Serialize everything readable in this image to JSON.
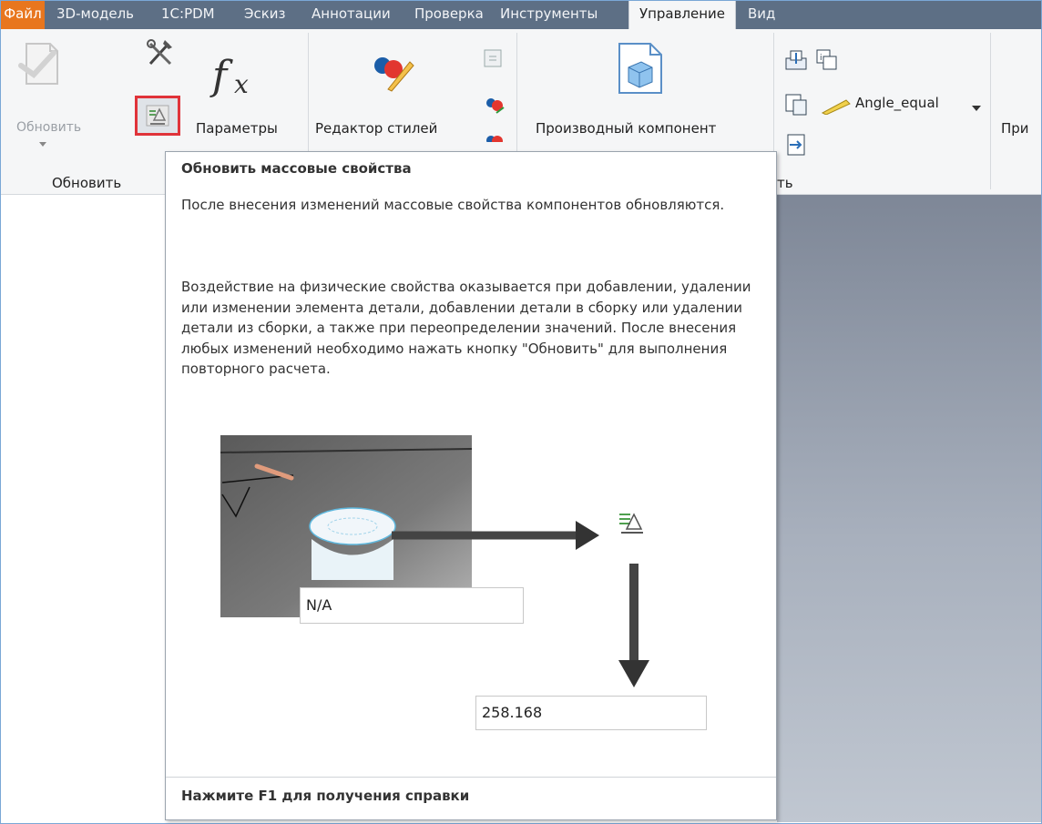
{
  "tabs": [
    {
      "label": "Файл"
    },
    {
      "label": "3D-модель"
    },
    {
      "label": "1C:PDM"
    },
    {
      "label": "Эскиз"
    },
    {
      "label": "Аннотации"
    },
    {
      "label": "Проверка"
    },
    {
      "label": "Инструменты"
    },
    {
      "label": "Управление"
    },
    {
      "label": "Вид"
    }
  ],
  "ribbon": {
    "update_label": "Обновить",
    "update_group_label": "Обновить",
    "params_label": "Параметры",
    "style_editor_label": "Редактор стилей",
    "derived_label": "Производный компонент",
    "angle_dropdown_value": "Angle_equal",
    "partial_group_label": "ть",
    "partial_right_label": "При"
  },
  "tooltip": {
    "title": "Обновить массовые свойства",
    "para1": "После внесения изменений массовые свойства компонентов обновляются.",
    "para2": "Воздействие на физические свойства оказывается при добавлении, удалении или изменении элемента детали, добавлении детали в сборку или удалении детали из сборки, а также при переопределении значений. После внесения любых изменений необходимо нажать кнопку \"Обновить\" для выполнения повторного расчета.",
    "field_before": "N/A",
    "field_after": "258.168",
    "footer": "Нажмите F1 для получения справки"
  }
}
